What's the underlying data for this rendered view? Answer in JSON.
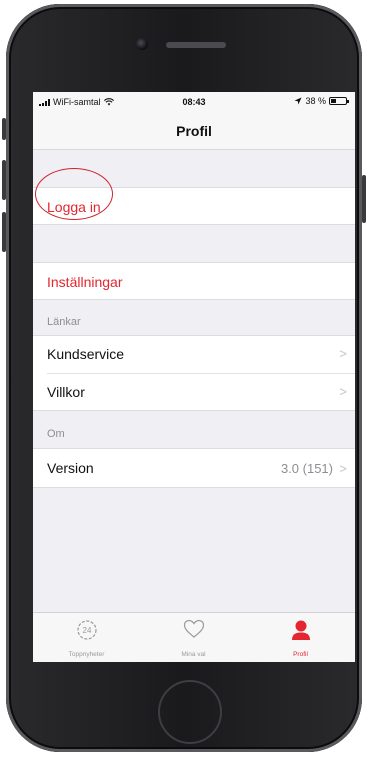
{
  "status_bar": {
    "carrier": "WiFi-samtal",
    "time": "08:43",
    "battery": "38 %",
    "battery_level": 0.38
  },
  "nav": {
    "title": "Profil"
  },
  "login": {
    "label": "Logga in"
  },
  "settings": {
    "label": "Inställningar"
  },
  "links_section": {
    "header": "Länkar",
    "items": [
      {
        "label": "Kundservice"
      },
      {
        "label": "Villkor"
      }
    ]
  },
  "about_section": {
    "header": "Om",
    "version_label": "Version",
    "version_value": "3.0 (151)"
  },
  "tab_bar": {
    "tabs": [
      {
        "label": "Toppnyheter",
        "icon": "clock-24-icon"
      },
      {
        "label": "Mina val",
        "icon": "heart-icon"
      },
      {
        "label": "Profil",
        "icon": "person-icon",
        "active": true
      }
    ]
  },
  "colors": {
    "accent_red": "#e3262f",
    "background": "#efeff4"
  }
}
